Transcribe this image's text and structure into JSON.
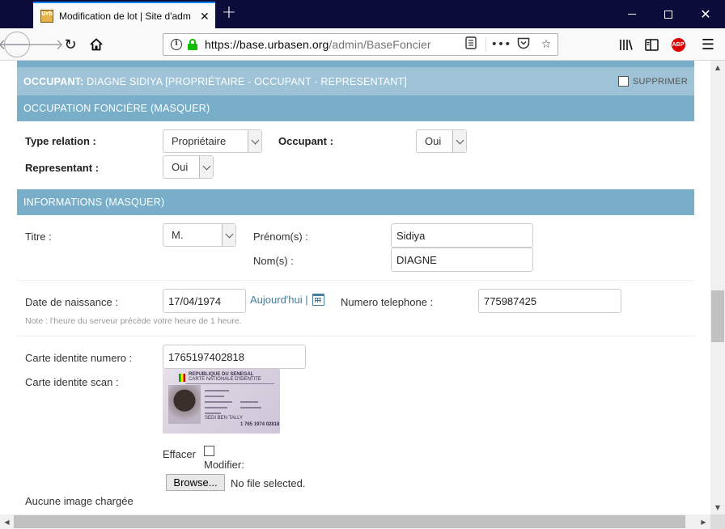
{
  "browser": {
    "tab_title": "Modification de lot | Site d'adm",
    "favicon_text": "UrbaDB",
    "url_host": "https://base.urbasen.org",
    "url_path": "/admin/BaseFoncier/l",
    "new_tab_symbol": "+",
    "abp_label": "ABP",
    "icons": [
      "back-arrow-icon",
      "forward-arrow-icon",
      "reload-icon",
      "home-icon",
      "info-icon",
      "lock-icon",
      "reader-view-icon",
      "page-actions-icon",
      "pocket-icon",
      "bookmark-star-icon",
      "library-icon",
      "sidebar-icon",
      "adblock-icon",
      "hamburger-menu-icon"
    ]
  },
  "occupant": {
    "header_prefix": "OCCUPANT:",
    "header_text": "DIAGNE SIDIYA [PROPRIÉTAIRE - OCCUPANT - REPRESENTANT]",
    "delete_label": "SUPPRIMER"
  },
  "occupation": {
    "header": "OCCUPATION FONCIÈRE (MASQUER)",
    "type_relation_label": "Type relation :",
    "type_relation_value": "Propriétaire",
    "occupant_label": "Occupant :",
    "occupant_value": "Oui",
    "representant_label": "Representant :",
    "representant_value": "Oui"
  },
  "informations": {
    "header": "INFORMATIONS (MASQUER)",
    "titre_label": "Titre :",
    "titre_value": "M.",
    "prenom_label": "Prénom(s) :",
    "prenom_value": "Sidiya",
    "nom_label": "Nom(s) :",
    "nom_value": "DIAGNE",
    "date_label": "Date de naissance :",
    "date_value": "17/04/1974",
    "today_link": "Aujourd'hui",
    "separator": "|",
    "phone_label": "Numero telephone :",
    "phone_value": "775987425",
    "note": "Note : l'heure du serveur précède votre heure de 1 heure.",
    "carte_num_label": "Carte identite numero :",
    "carte_num_value": "1765197402818",
    "carte_scan_label": "Carte identite scan :",
    "effacer_label": "Effacer",
    "modifier_label": "Modifier:",
    "browse_label": "Browse...",
    "no_file_label": "No file selected.",
    "no_image_label": "Aucune image chargée"
  },
  "idcard": {
    "line1": "REPUBLIQUE DU SENEGAL",
    "line2": "CARTE NATIONALE D'IDENTITE",
    "line3": "1 765 1974 02818",
    "line4": "SEDI BEN TALLY"
  }
}
